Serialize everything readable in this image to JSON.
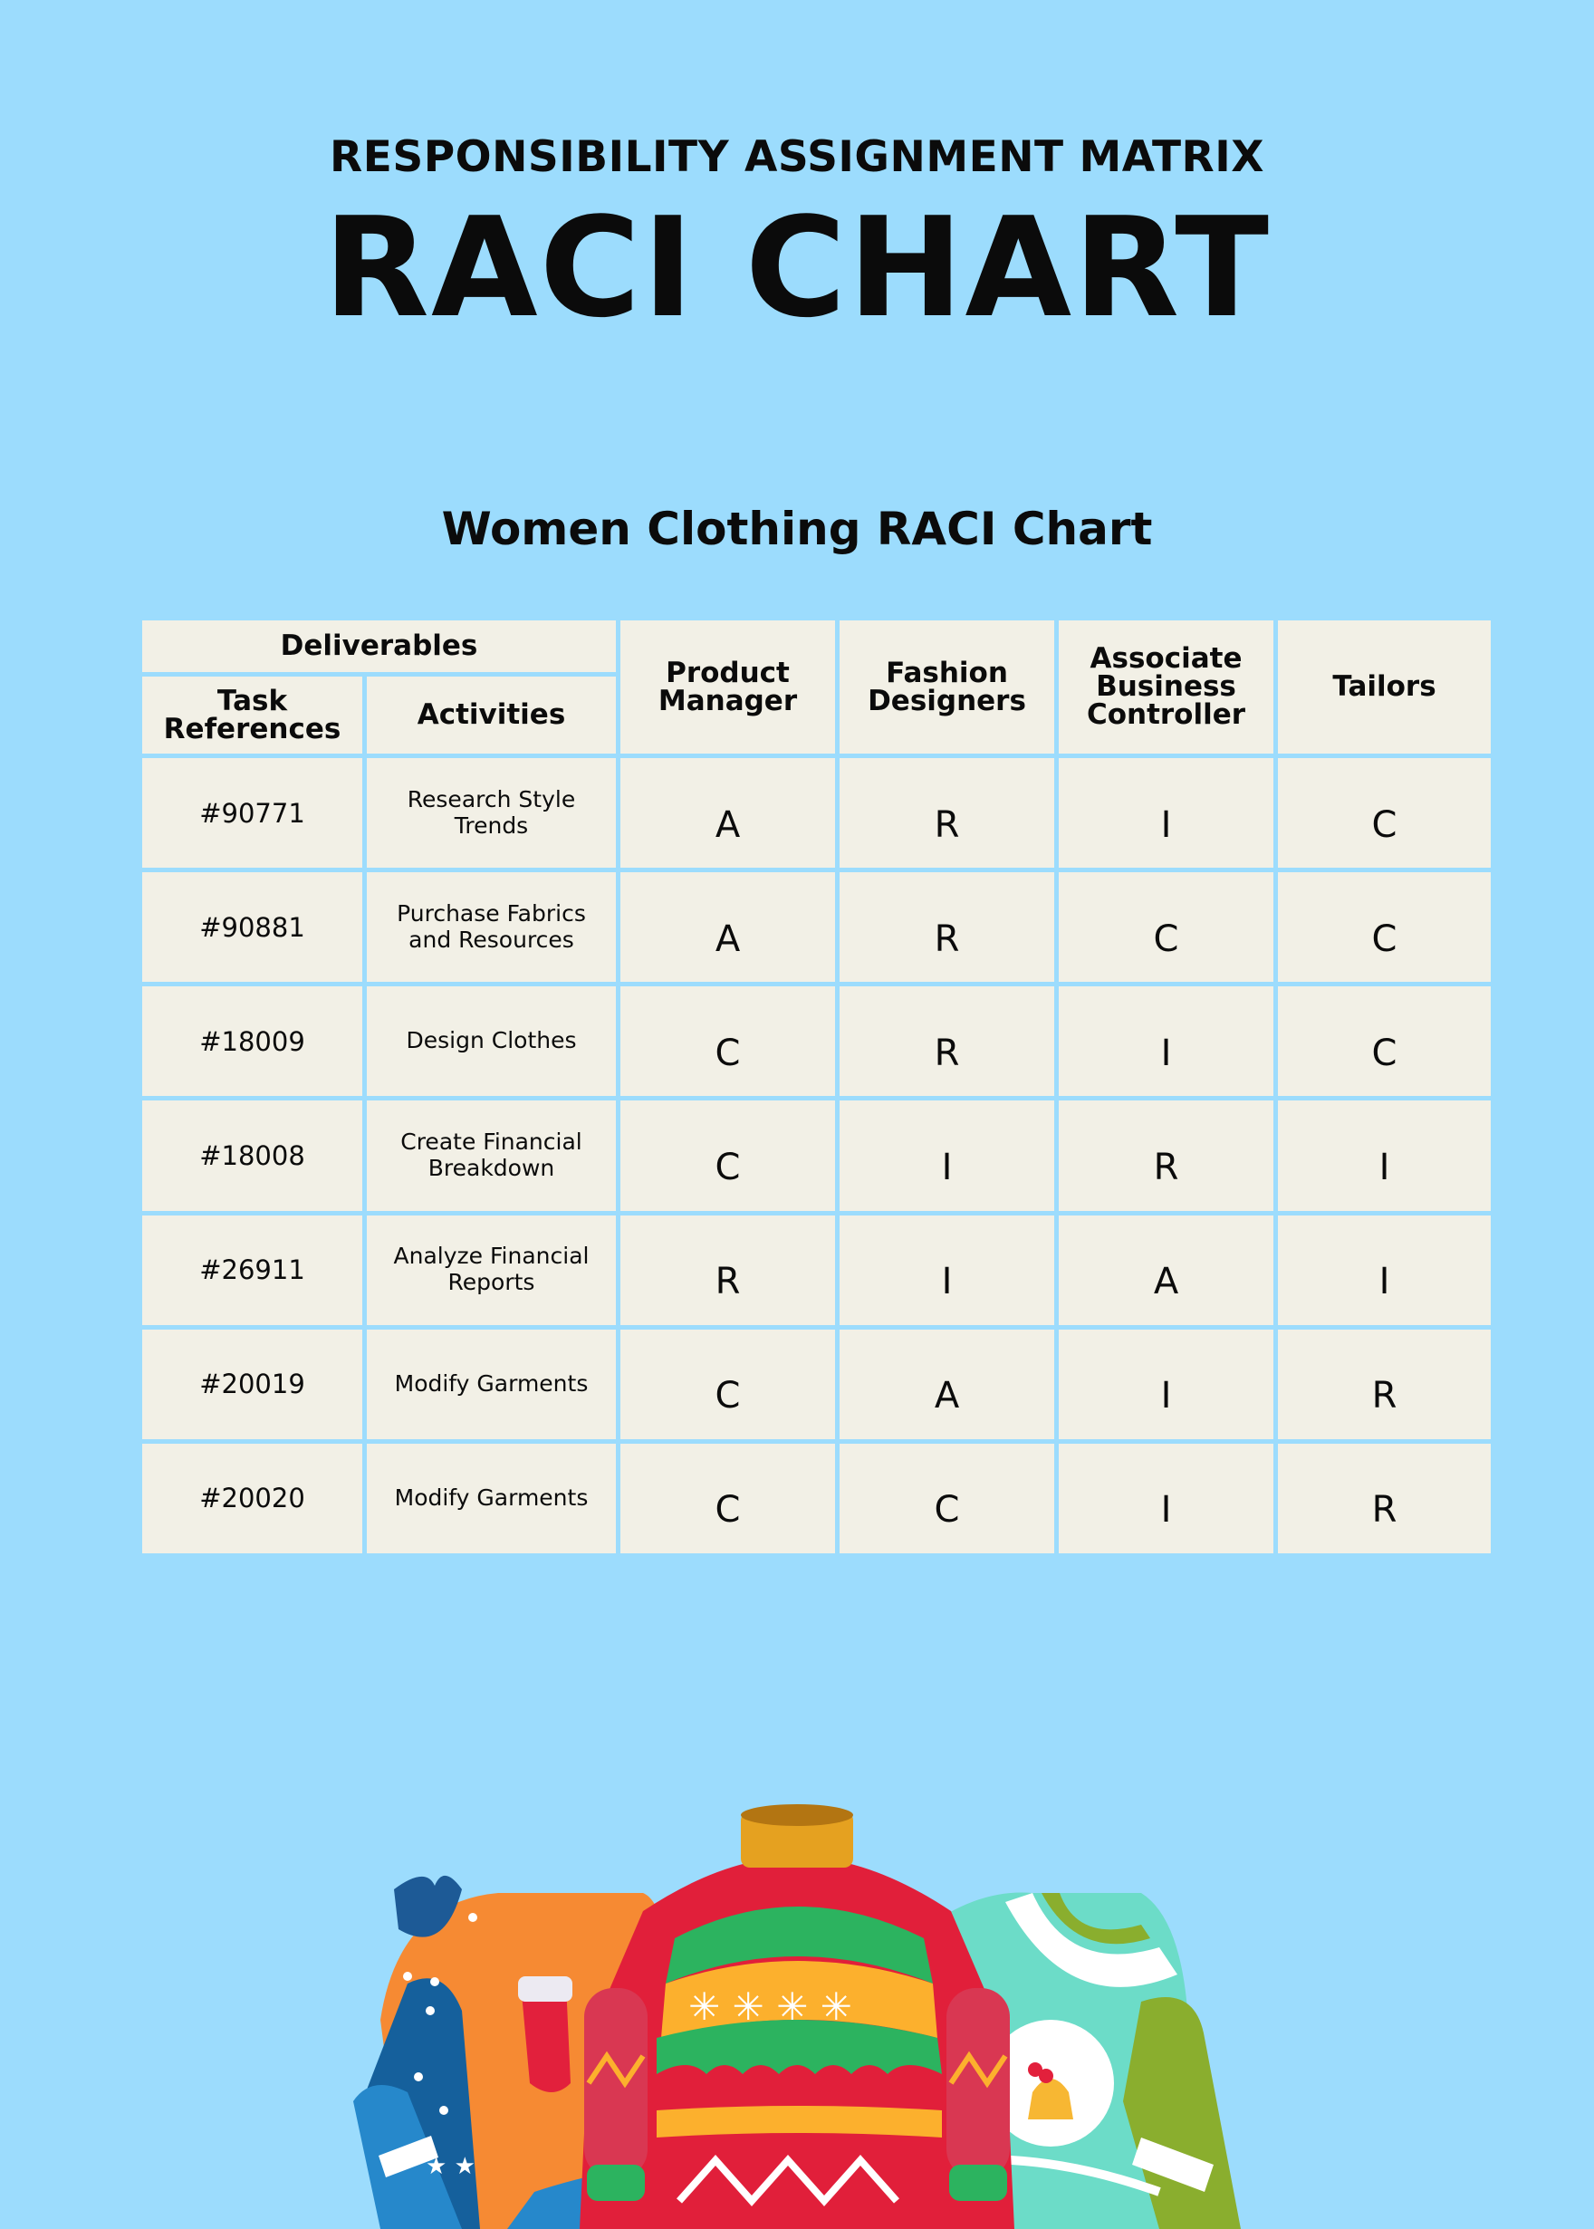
{
  "header": {
    "supertitle": "RESPONSIBILITY ASSIGNMENT MATRIX",
    "title": "RACI CHART",
    "subtitle": "Women Clothing RACI Chart"
  },
  "colors": {
    "background": "#9cdcfd",
    "cell_fill": "#f2f0e6",
    "text": "#0b0b0b"
  },
  "table": {
    "group_header": "Deliverables",
    "columns": {
      "task_ref": "Task References",
      "activities": "Activities",
      "roles": [
        "Product Manager",
        "Fashion Designers",
        "Associate Business Controller",
        "Tailors"
      ]
    },
    "rows": [
      {
        "ref": "#90771",
        "activity": "Research Style Trends",
        "raci": [
          "A",
          "R",
          "I",
          "C"
        ]
      },
      {
        "ref": "#90881",
        "activity": "Purchase Fabrics and Resources",
        "raci": [
          "A",
          "R",
          "C",
          "C"
        ]
      },
      {
        "ref": "#18009",
        "activity": "Design Clothes",
        "raci": [
          "C",
          "R",
          "I",
          "C"
        ]
      },
      {
        "ref": "#18008",
        "activity": "Create Financial Breakdown",
        "raci": [
          "C",
          "I",
          "R",
          "I"
        ]
      },
      {
        "ref": "#26911",
        "activity": "Analyze Financial Reports",
        "raci": [
          "R",
          "I",
          "A",
          "I"
        ]
      },
      {
        "ref": "#20019",
        "activity": "Modify Garments",
        "raci": [
          "C",
          "A",
          "I",
          "R"
        ]
      },
      {
        "ref": "#20020",
        "activity": "Modify Garments",
        "raci": [
          "C",
          "C",
          "I",
          "R"
        ]
      }
    ]
  },
  "illustration": {
    "subject": "three-christmas-sweaters",
    "sweaters": [
      "orange-blue-stocking-sweater",
      "red-green-yellow-snowflake-sweater",
      "teal-green-bell-sweater"
    ]
  }
}
